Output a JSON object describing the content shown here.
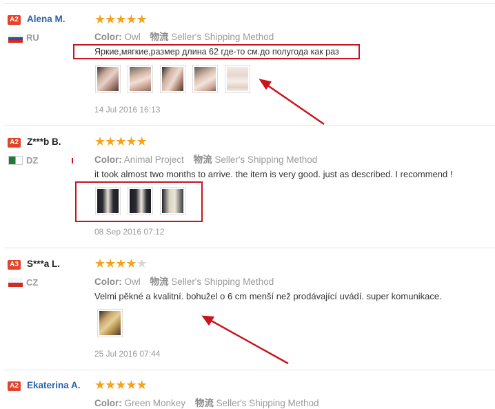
{
  "reviews": [
    {
      "badge": "A2",
      "name": "Alena M.",
      "country": "RU",
      "rating": 5,
      "color_label": "Color:",
      "color_value": "Owl",
      "ship_label": "物流",
      "ship_value": "Seller's Shipping Method",
      "comment": "Яркие,мягкие,размер длина 62 где-то см.до полугода как раз",
      "photos": 5,
      "timestamp": "14 Jul 2016 16:13"
    },
    {
      "badge": "A2",
      "name": "Z***b B.",
      "country": "DZ",
      "rating": 5,
      "color_label": "Color:",
      "color_value": "Animal Project",
      "ship_label": "物流",
      "ship_value": "Seller's Shipping Method",
      "comment": "it took almost two months to arrive. the item is very good. just as described. I recommend !",
      "photos": 3,
      "timestamp": "08 Sep 2016 07:12"
    },
    {
      "badge": "A3",
      "name": "S***a L.",
      "country": "CZ",
      "rating": 4,
      "color_label": "Color:",
      "color_value": "Owl",
      "ship_label": "物流",
      "ship_value": "Seller's Shipping Method",
      "comment": "Velmi pěkné a kvalitní. bohužel o 6 cm menší než prodávající uvádí. super komunikace.",
      "photos": 1,
      "timestamp": "25 Jul 2016 07:44"
    },
    {
      "badge": "A2",
      "name": "Ekaterina A.",
      "country": "",
      "rating": 5,
      "color_label": "Color:",
      "color_value": "Green Monkey",
      "ship_label": "物流",
      "ship_value": "Seller's Shipping Method",
      "comment": "",
      "photos": 0,
      "timestamp": ""
    }
  ],
  "colors": {
    "star": "#f7a11c",
    "badge": "#e2432b",
    "link": "#2a62a8",
    "annotation": "#c8141e"
  },
  "icons": [
    "star-icon",
    "flag-ru-icon",
    "flag-dz-icon",
    "flag-cz-icon"
  ]
}
